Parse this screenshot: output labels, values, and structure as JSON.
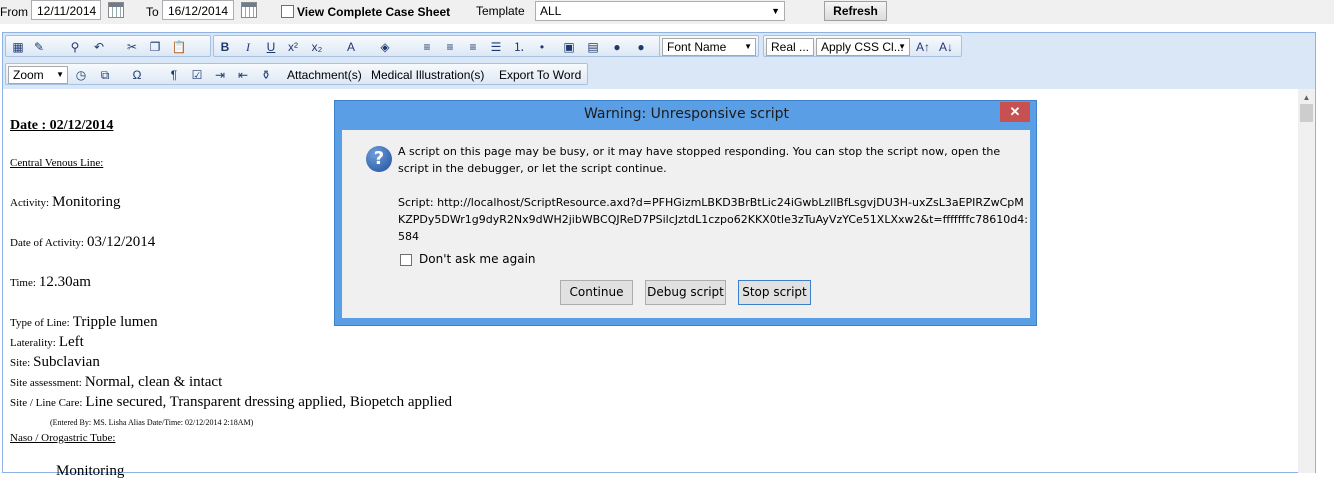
{
  "filter_bar": {
    "from_label": "From",
    "from_value": "12/11/2014",
    "to_label": "To",
    "to_value": "16/12/2014",
    "view_sheet_label": "View Complete Case Sheet",
    "template_label": "Template",
    "template_value": "ALL",
    "refresh_label": "Refresh"
  },
  "toolbar": {
    "font_name": "Font Name",
    "font_size": "Real ...",
    "css_class": "Apply CSS Cl...",
    "zoom": "Zoom",
    "attachments": "Attachment(s)",
    "medical_illustration": "Medical Illustration(s)",
    "export_word": "Export To Word",
    "icons": [
      "table-icon",
      "format-painter-icon",
      "find-icon",
      "undo-icon",
      "cut-icon",
      "copy-icon",
      "paste-icon",
      "bold-icon",
      "italic-icon",
      "underline-icon",
      "superscript-icon",
      "subscript-icon",
      "font-color-icon",
      "highlight-icon",
      "align-left-icon",
      "align-center-icon",
      "align-right-icon",
      "justify-icon",
      "numbered-list-icon",
      "bulleted-list-icon",
      "insert-image-icon",
      "insert-doc-icon",
      "insert-link-icon",
      "remove-link-icon",
      "grow-font-icon",
      "shrink-font-icon",
      "clock-icon",
      "insert-media-icon",
      "symbol-icon",
      "paragraph-icon",
      "spellcheck-icon",
      "indent-icon",
      "outdent-icon",
      "clean-icon"
    ]
  },
  "document": {
    "date_heading": "Date : 02/12/2014",
    "cvl_heading": "Central Venous Line:",
    "activity_label": "Activity:",
    "activity_value": "Monitoring",
    "date_activity_label": "Date of Activity:",
    "date_activity_value": "03/12/2014",
    "time_label": "Time:",
    "time_value": "12.30am",
    "type_label": "Type of Line:",
    "type_value": "Tripple lumen",
    "laterality_label": "Laterality:",
    "laterality_value": "Left",
    "site_label": "Site:",
    "site_value": "Subclavian",
    "site_assessment_label": "Site assessment:",
    "site_assessment_value": "Normal, clean & intact",
    "site_care_label": "Site / Line Care:",
    "site_care_value": "Line secured, Transparent dressing applied, Biopetch applied",
    "entered_by": "(Entered By: MS. Lisha Alias Date/Time: 02/12/2014 2:18AM)",
    "naso_heading": "Naso / Orogastric Tube:",
    "partial_next": "Monitoring"
  },
  "dialog": {
    "title": "Warning: Unresponsive script",
    "close_glyph": "✕",
    "question_glyph": "?",
    "message": "A script on this page may be busy, or it may have stopped responding. You can stop the script now, open the script in the debugger, or let the script continue.",
    "script_text": "Script: http://localhost/ScriptResource.axd?d=PFHGizmLBKD3BrBtLic24iGwbLzllBfLsgvjDU3H-uxZsL3aEPIRZwCpMKZPDy5DWr1g9dyR2Nx9dWH2jibWBCQJReD7PSilcJztdL1czpo62KKX0tle3zTuAyVzYCe51XLXxw2&t=fffffffc78610d4:584",
    "dont_ask_label": "Don't ask me again",
    "continue_label": "Continue",
    "debug_label": "Debug script",
    "stop_label": "Stop script"
  }
}
